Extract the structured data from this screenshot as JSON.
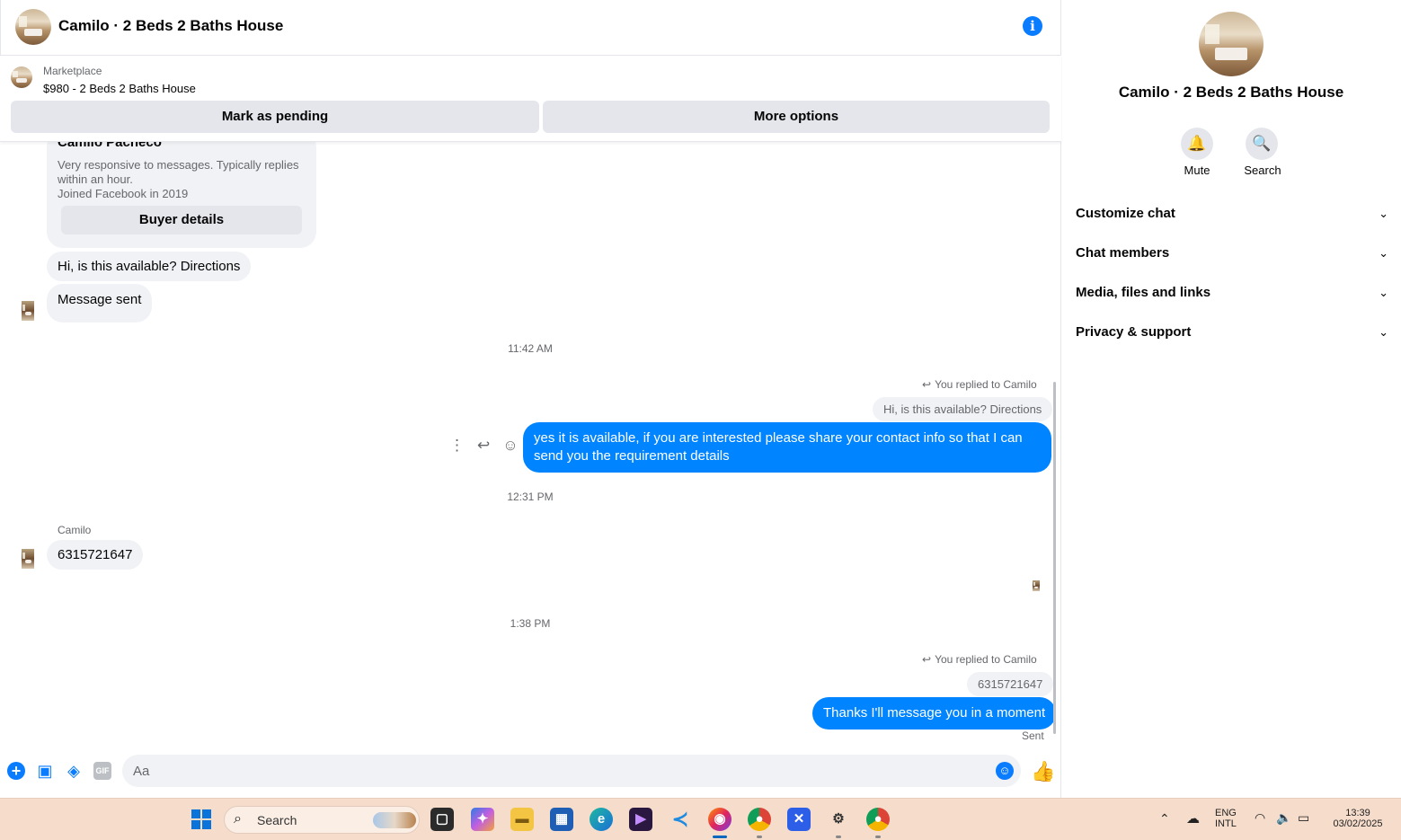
{
  "header": {
    "title": "Camilo · 2 Beds 2 Baths House",
    "info_icon": "info-icon"
  },
  "marketplace": {
    "label": "Marketplace",
    "item": "$980 - 2 Beds 2 Baths House",
    "mark_pending": "Mark as pending",
    "more_options": "More options"
  },
  "seller_card": {
    "name": "Camilo Pacheco",
    "description": "Very responsive to messages. Typically replies within an hour.",
    "joined": "Joined Facebook in 2019",
    "buyer_details": "Buyer details"
  },
  "messages": {
    "in_1": "Hi, is this available? Directions",
    "in_2": "Message sent",
    "time_1": "11:42 AM",
    "reply_label_1": "You replied to Camilo",
    "quoted_1": "Hi, is this available? Directions",
    "out_1": "yes it is available, if you are interested please share your contact info so that I can send you the requirement details",
    "time_2": "12:31 PM",
    "sender_2": "Camilo",
    "in_3": "6315721647",
    "time_3": "1:38 PM",
    "reply_label_2": "You replied to Camilo",
    "quoted_2": "6315721647",
    "out_2": "Thanks I'll message you in a moment",
    "status": "Sent"
  },
  "composer": {
    "placeholder": "Aa",
    "gif_label": "GIF"
  },
  "info_panel": {
    "name": "Camilo · 2 Beds 2 Baths House",
    "mute": "Mute",
    "search": "Search",
    "sections": [
      "Customize chat",
      "Chat members",
      "Media, files and links",
      "Privacy & support"
    ]
  },
  "taskbar": {
    "search_placeholder": "Search",
    "lang_1": "ENG",
    "lang_2": "INTL",
    "time": "13:39",
    "date": "03/02/2025"
  },
  "colors": {
    "accent": "#0084ff",
    "bubble_in": "#f0f2f5",
    "taskbar": "#f6dccb"
  }
}
